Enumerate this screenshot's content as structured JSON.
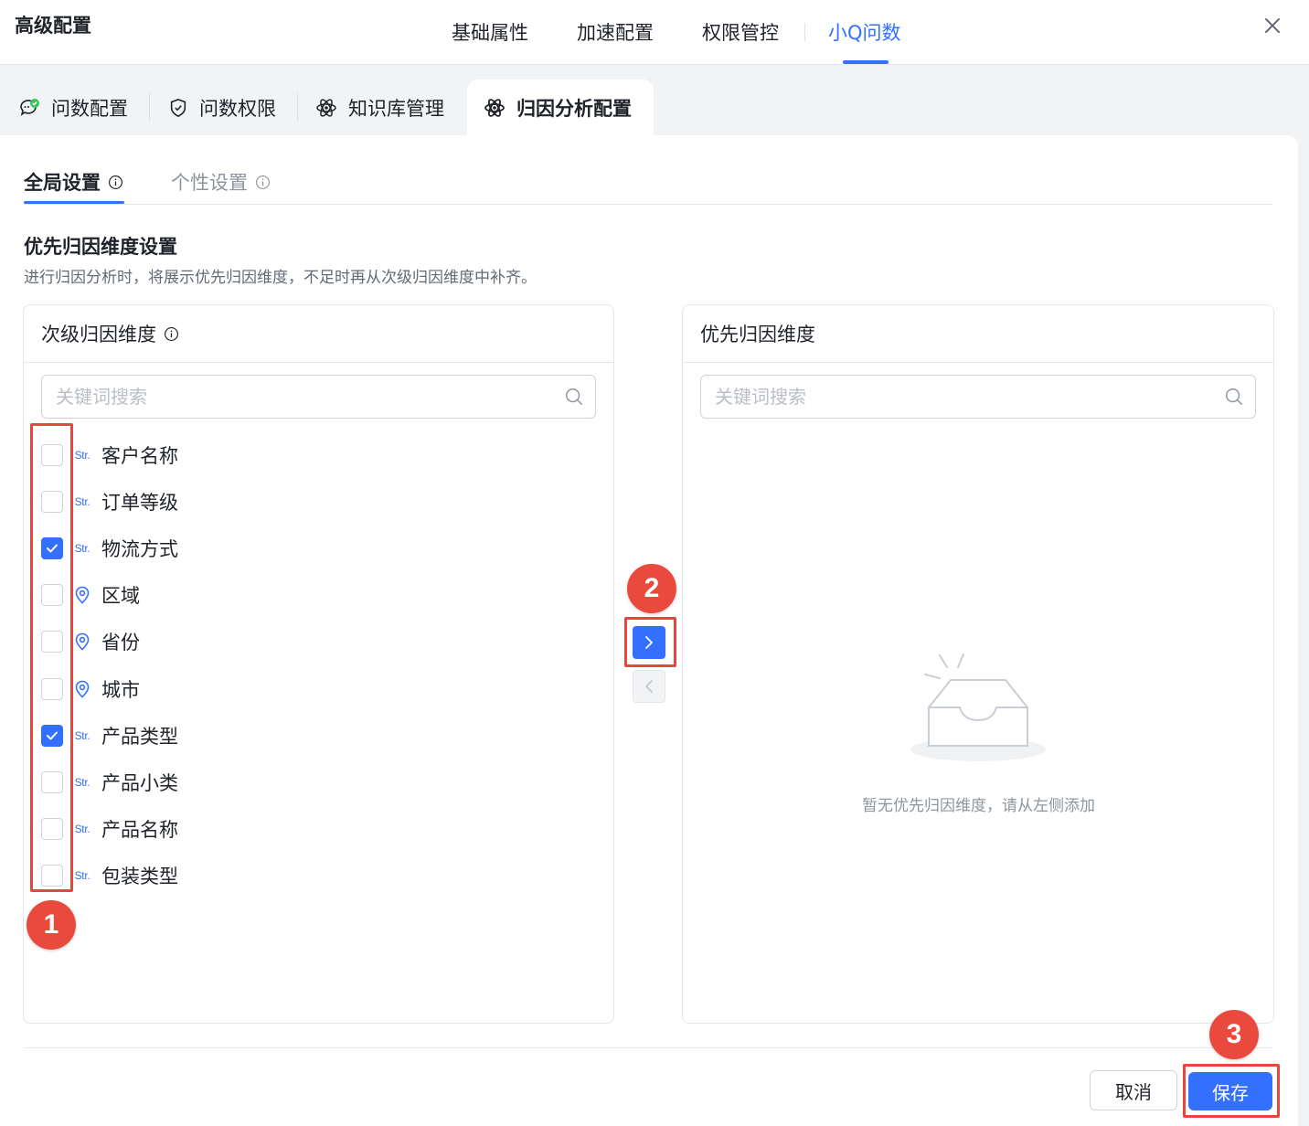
{
  "header": {
    "title": "高级配置",
    "tabs": [
      "基础属性",
      "加速配置",
      "权限管控",
      "小Q问数"
    ],
    "active_tab": "小Q问数"
  },
  "sub_tabs": [
    {
      "label": "问数配置",
      "icon": "chat-check-icon"
    },
    {
      "label": "问数权限",
      "icon": "shield-check-icon"
    },
    {
      "label": "知识库管理",
      "icon": "atom-icon"
    },
    {
      "label": "归因分析配置",
      "icon": "atom-icon"
    }
  ],
  "active_sub_tab": "归因分析配置",
  "inner_tabs": [
    "全局设置",
    "个性设置"
  ],
  "active_inner_tab": "全局设置",
  "section": {
    "title": "优先归因维度设置",
    "description": "进行归因分析时，将展示优先归因维度，不足时再从次级归因维度中补齐。"
  },
  "left_panel": {
    "title": "次级归因维度",
    "search_placeholder": "关键词搜索",
    "items": [
      {
        "label": "客户名称",
        "type": "Str.",
        "checked": false
      },
      {
        "label": "订单等级",
        "type": "Str.",
        "checked": false
      },
      {
        "label": "物流方式",
        "type": "Str.",
        "checked": true
      },
      {
        "label": "区域",
        "type": "geo",
        "checked": false
      },
      {
        "label": "省份",
        "type": "geo",
        "checked": false
      },
      {
        "label": "城市",
        "type": "geo",
        "checked": false
      },
      {
        "label": "产品类型",
        "type": "Str.",
        "checked": true
      },
      {
        "label": "产品小类",
        "type": "Str.",
        "checked": false
      },
      {
        "label": "产品名称",
        "type": "Str.",
        "checked": false
      },
      {
        "label": "包装类型",
        "type": "Str.",
        "checked": false
      }
    ]
  },
  "right_panel": {
    "title": "优先归因维度",
    "search_placeholder": "关键词搜索",
    "empty_text": "暂无优先归因维度，请从左侧添加"
  },
  "footer": {
    "cancel_label": "取消",
    "save_label": "保存"
  },
  "callouts": [
    "1",
    "2",
    "3"
  ],
  "colors": {
    "accent": "#3370ff",
    "callout": "#ea4a3d"
  }
}
